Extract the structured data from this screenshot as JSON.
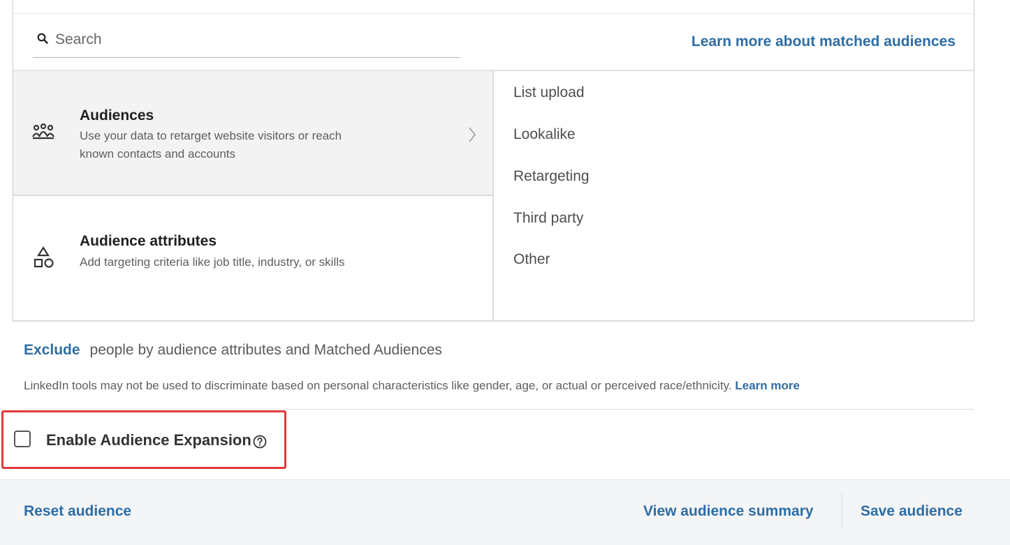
{
  "search": {
    "placeholder": "Search",
    "learn_more_label": "Learn more about matched audiences"
  },
  "categories": [
    {
      "title": "Audiences",
      "description": "Use your data to retarget website visitors or reach known contacts and accounts",
      "icon": "people-group-icon",
      "active": true
    },
    {
      "title": "Audience attributes",
      "description": "Add targeting criteria like job title, industry, or skills",
      "icon": "shapes-icon",
      "active": false
    }
  ],
  "subcategories": [
    "List upload",
    "Lookalike",
    "Retargeting",
    "Third party",
    "Other"
  ],
  "exclude": {
    "link_label": "Exclude",
    "text": "people by audience attributes and Matched Audiences"
  },
  "disclaimer": {
    "text": "LinkedIn tools may not be used to discriminate based on personal characteristics like gender, age, or actual or perceived race/ethnicity.",
    "learn_more_label": "Learn more"
  },
  "audience_expansion": {
    "label": "Enable Audience Expansion",
    "checked": false
  },
  "footer": {
    "reset_label": "Reset audience",
    "summary_label": "View audience summary",
    "save_label": "Save audience"
  },
  "colors": {
    "link": "#2e6da4",
    "highlight": "#e03a3a",
    "active_bg": "#f3f3f3"
  }
}
